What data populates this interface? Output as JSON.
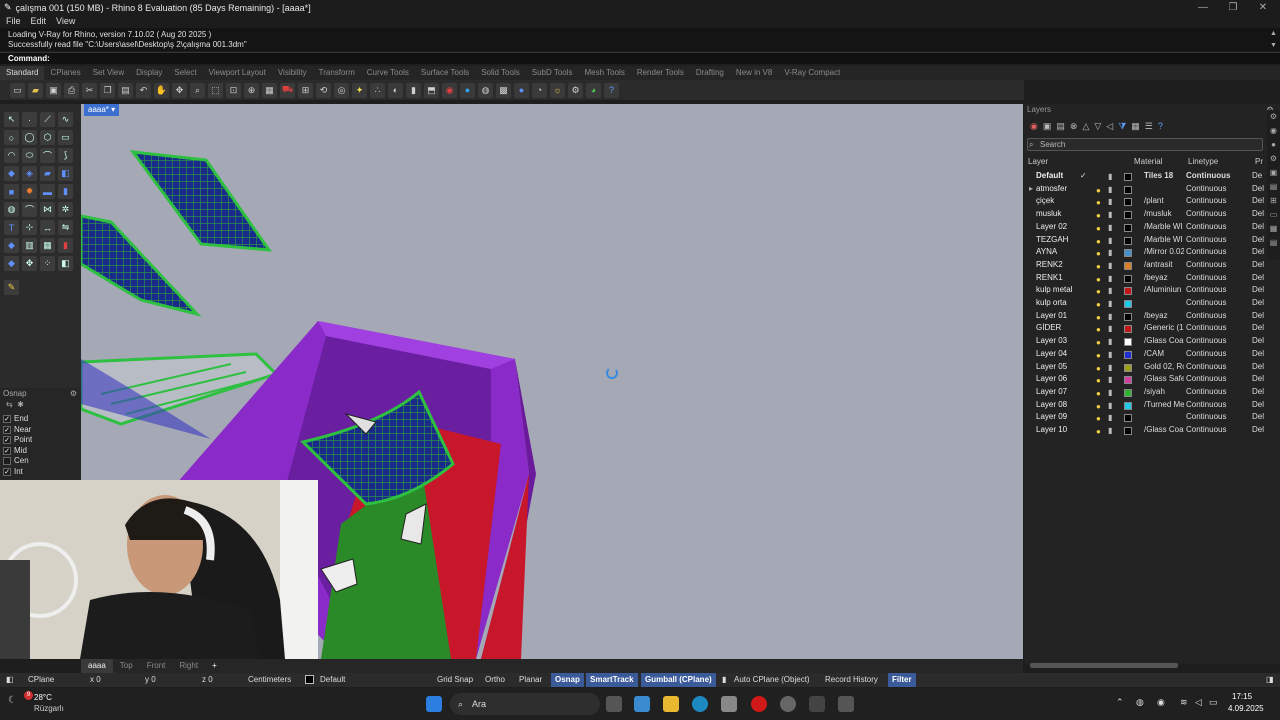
{
  "window": {
    "title": "çalışma 001 (150 MB) - Rhino 8 Evaluation (85 Days Remaining) - [aaaa*]",
    "minimize": "—",
    "maximize": "❐",
    "close": "✕"
  },
  "menu": [
    "File",
    "Edit",
    "View"
  ],
  "history": [
    "Loading V-Ray for Rhino, version 7.10.02 ( Aug 20 2025 )",
    "Successfully read file \"C:\\Users\\asel\\Desktop\\ş 2\\çalışma 001.3dm\""
  ],
  "command_label": "Command:",
  "toolbar_tabs": [
    "Standard",
    "CPlanes",
    "Set View",
    "Display",
    "Select",
    "Viewport Layout",
    "Visibility",
    "Transform",
    "Curve Tools",
    "Surface Tools",
    "Solid Tools",
    "SubD Tools",
    "Mesh Tools",
    "Render Tools",
    "Drafting",
    "New in V8",
    "V-Ray Compact"
  ],
  "viewport_tab": "aaaa*",
  "osnap": {
    "title": "Osnap",
    "items": [
      {
        "label": "End",
        "checked": true
      },
      {
        "label": "Near",
        "checked": true
      },
      {
        "label": "Point",
        "checked": true
      },
      {
        "label": "Mid",
        "checked": true
      },
      {
        "label": "Cen",
        "checked": false
      },
      {
        "label": "Int",
        "checked": true
      }
    ]
  },
  "layers": {
    "panel_title": "Layers",
    "search_placeholder": "Search",
    "columns": {
      "layer": "Layer",
      "material": "Material",
      "linetype": "Linetype",
      "print": "Pr"
    },
    "rows": [
      {
        "name": "Default",
        "material": "Tiles 18",
        "linetype": "Continuous",
        "print": "De",
        "color": "#000000",
        "bold": true
      },
      {
        "name": "atmosfer",
        "material": "",
        "linetype": "Continuous",
        "print": "Del",
        "color": "#000000"
      },
      {
        "name": "çiçek",
        "material": "/plant",
        "linetype": "Continuous",
        "print": "Del",
        "color": "#000000"
      },
      {
        "name": "musluk",
        "material": "/musluk",
        "linetype": "Continuous",
        "print": "Del",
        "color": "#000000"
      },
      {
        "name": "Layer 02",
        "material": "/Marble WI",
        "linetype": "Continuous",
        "print": "Del",
        "color": "#000000"
      },
      {
        "name": "TEZGAH",
        "material": "/Marble WI",
        "linetype": "Continuous",
        "print": "Del",
        "color": "#000000"
      },
      {
        "name": "AYNA",
        "material": "/Mirror 0.02",
        "linetype": "Continuous",
        "print": "Del",
        "color": "#4a90c8"
      },
      {
        "name": "RENK2",
        "material": "/antrasit",
        "linetype": "Continuous",
        "print": "Del",
        "color": "#d98030"
      },
      {
        "name": "RENK1",
        "material": "/beyaz",
        "linetype": "Continuous",
        "print": "Del",
        "color": "#000000"
      },
      {
        "name": "kulp metal",
        "material": "/Aluminiun",
        "linetype": "Continuous",
        "print": "Del",
        "color": "#c01818"
      },
      {
        "name": "kulp orta",
        "material": "",
        "linetype": "Continuous",
        "print": "Del",
        "color": "#22c8e8"
      },
      {
        "name": "Layer 01",
        "material": "/beyaz",
        "linetype": "Continuous",
        "print": "Del",
        "color": "#000000"
      },
      {
        "name": "GİDER",
        "material": "/Generic (1)",
        "linetype": "Continuous",
        "print": "Del",
        "color": "#c01818"
      },
      {
        "name": "Layer 03",
        "material": "/Glass Coat",
        "linetype": "Continuous",
        "print": "Del",
        "color": "#ffffff"
      },
      {
        "name": "Layer 04",
        "material": "/CAM",
        "linetype": "Continuous",
        "print": "Del",
        "color": "#2030d0"
      },
      {
        "name": "Layer 05",
        "material": "Gold 02, Ro",
        "linetype": "Continuous",
        "print": "Del",
        "color": "#a0a020"
      },
      {
        "name": "Layer 06",
        "material": "/Glass Safet",
        "linetype": "Continuous",
        "print": "Del",
        "color": "#d040a0"
      },
      {
        "name": "Layer 07",
        "material": "/siyah",
        "linetype": "Continuous",
        "print": "Del",
        "color": "#30b030"
      },
      {
        "name": "Layer 08",
        "material": "/Turned Me",
        "linetype": "Continuous",
        "print": "Del",
        "color": "#22c8e8"
      },
      {
        "name": "Layer 09",
        "material": "",
        "linetype": "Continuous",
        "print": "Del",
        "color": "#000000"
      },
      {
        "name": "Layer 10",
        "material": "/Glass Coat",
        "linetype": "Continuous",
        "print": "Del",
        "color": "#000000"
      }
    ]
  },
  "bottom_tabs": [
    "aaaa",
    "Top",
    "Front",
    "Right",
    "+"
  ],
  "status": {
    "cplane": "CPlane",
    "x": "x 0",
    "y": "y 0",
    "z": "z 0",
    "units": "Centimeters",
    "layer": "Default",
    "grid_snap": "Grid Snap",
    "ortho": "Ortho",
    "planar": "Planar",
    "osnap": "Osnap",
    "smarttrack": "SmartTrack",
    "gumball": "Gumball (CPlane)",
    "auto_cplane": "Auto CPlane (Object)",
    "record_history": "Record History",
    "filter": "Filter"
  },
  "taskbar": {
    "temp": "28°C",
    "weather": "Rüzgarlı",
    "search": "Ara",
    "time": "17:15",
    "date": "4.09.2025",
    "badge": "9"
  }
}
